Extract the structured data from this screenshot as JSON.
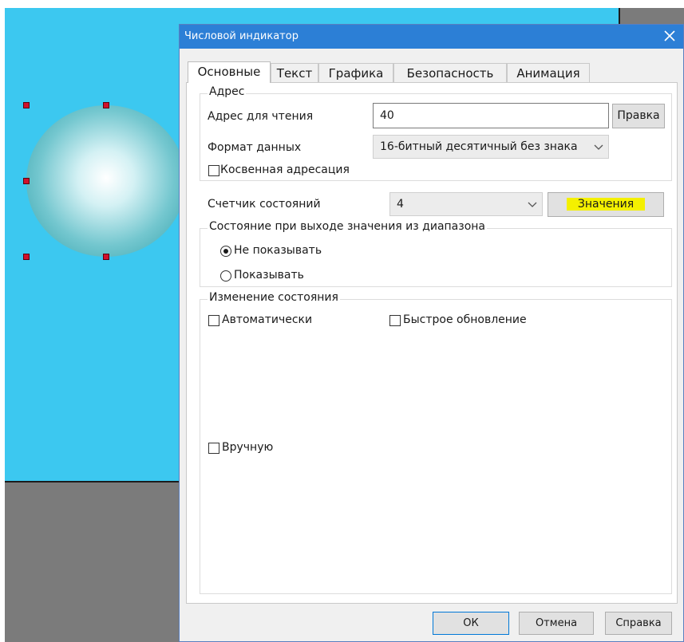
{
  "dialog": {
    "title": "Числовой индикатор",
    "close_glyph": "✕"
  },
  "tabs": [
    {
      "label": "Основные",
      "active": true
    },
    {
      "label": "Текст",
      "active": false
    },
    {
      "label": "Графика",
      "active": false
    },
    {
      "label": "Безопасность",
      "active": false
    },
    {
      "label": "Анимация",
      "active": false
    }
  ],
  "address_group": {
    "label": "Адрес",
    "read_address_label": "Адрес для чтения",
    "read_address_value": "40",
    "edit_button": "Правка",
    "data_format_label": "Формат данных",
    "data_format_value": "16-битный десятичный без знака",
    "indirect_label": "Косвенная адресация",
    "indirect_checked": false
  },
  "state_counter": {
    "label": "Счетчик состояний",
    "value": "4",
    "values_button": "Значения",
    "highlight_color": "#f4f000"
  },
  "out_of_range": {
    "label": "Состояние при выходе значения из диапазона",
    "option_hide": "Не показывать",
    "option_show": "Показывать",
    "selected": "Не показывать"
  },
  "state_change": {
    "label": "Изменение состояния",
    "auto_label": "Автоматически",
    "fast_update_label": "Быстрое обновление",
    "manual_label": "Вручную"
  },
  "footer": {
    "ok": "ОК",
    "cancel": "Отмена",
    "help": "Справка"
  },
  "colors": {
    "canvas": "#3cc8f0",
    "titlebar": "#2c7fd6",
    "handle": "#d0102a"
  }
}
